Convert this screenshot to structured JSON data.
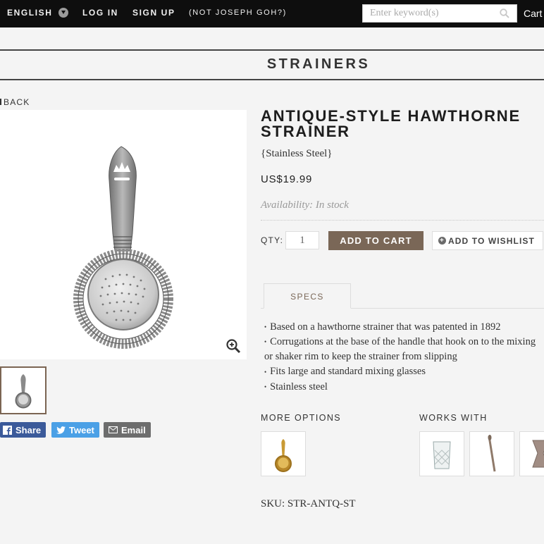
{
  "topbar": {
    "language": "ENGLISH",
    "login": "LOG IN",
    "signup": "SIGN UP",
    "not_user": "(NOT JOSEPH GOH?)",
    "search_placeholder": "Enter keyword(s)",
    "cart": "Cart"
  },
  "category": {
    "title": "STRAINERS"
  },
  "back": "BACK",
  "product": {
    "title": "ANTIQUE-STYLE HAWTHORNE STRAINER",
    "variant": "{Stainless Steel}",
    "price": "US$19.99",
    "availability": "Availability: In stock",
    "qty_label": "QTY:",
    "qty_value": "1",
    "add_to_cart": "ADD TO CART",
    "add_to_wishlist": "ADD TO WISHLIST",
    "tab_specs": "SPECS",
    "specs": [
      "Based on a hawthorne strainer that was patented in 1892",
      "Corrugations at the base of the handle that hook on to the mixing or shaker rim to keep the strainer from slipping",
      "Fits large and standard mixing glasses",
      "Stainless steel"
    ],
    "more_options_label": "MORE OPTIONS",
    "works_with_label": "WORKS WITH",
    "sku": "SKU: STR-ANTQ-ST"
  },
  "share": {
    "facebook": "Share",
    "twitter": "Tweet",
    "email": "Email"
  },
  "colors": {
    "accent": "#7a6757",
    "topbar": "#0e0e0e",
    "facebook": "#3b5a9a",
    "twitter": "#4ba0e6"
  }
}
